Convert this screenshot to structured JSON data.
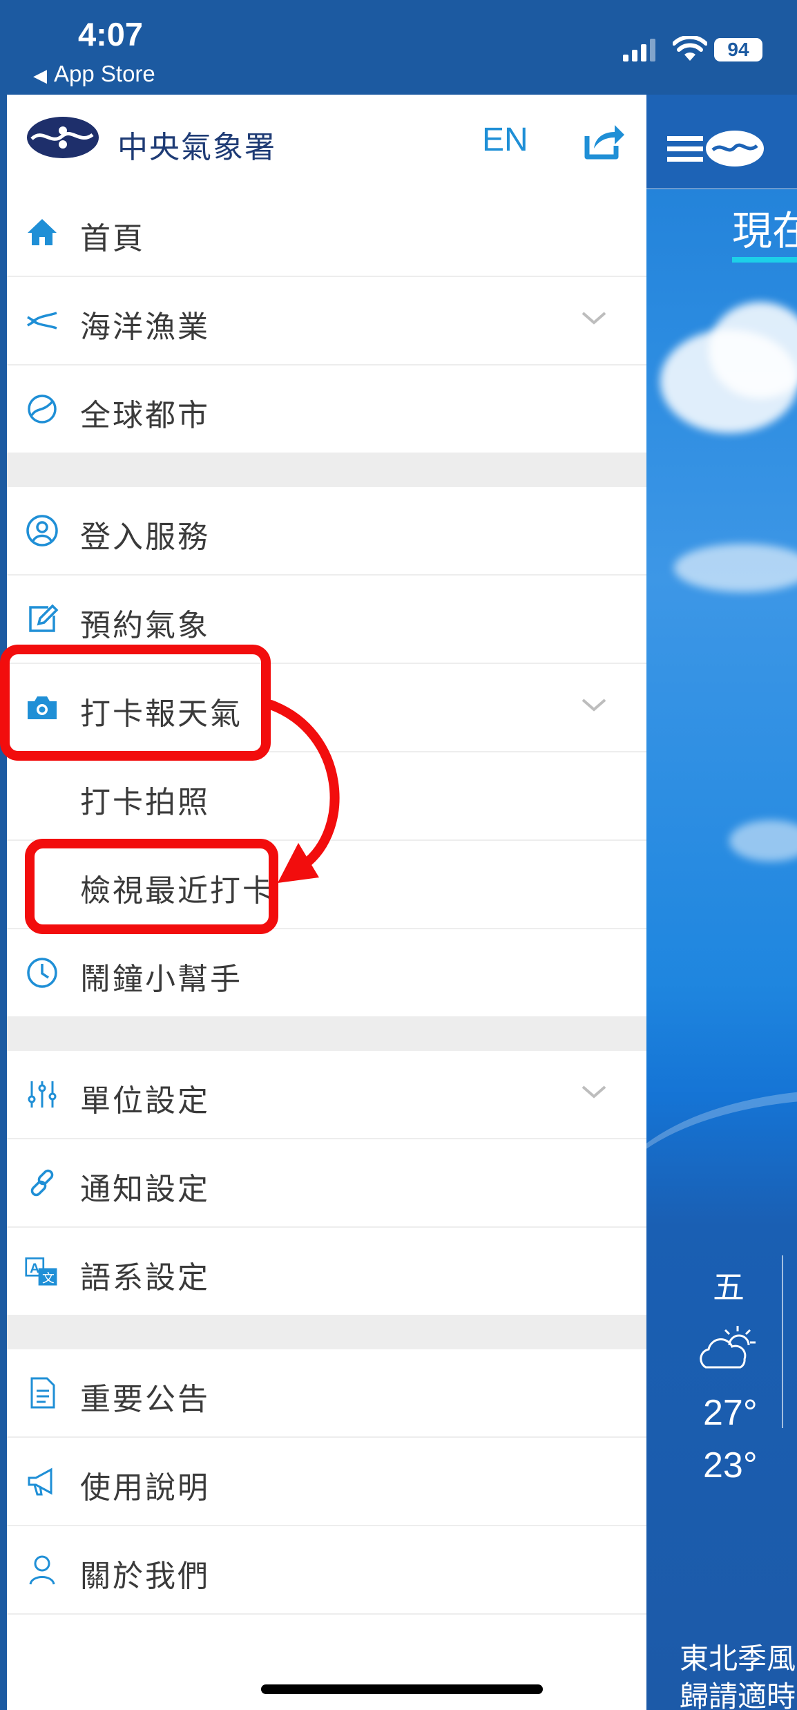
{
  "status_bar": {
    "time": "4:07",
    "back_label": "App Store",
    "battery": "94"
  },
  "drawer": {
    "org_name": "中央氣象署",
    "lang_button": "EN",
    "items": [
      {
        "label": "首頁",
        "icon": "home-icon"
      },
      {
        "label": "海洋漁業",
        "icon": "fish-icon",
        "expandable": true
      },
      {
        "label": "全球都市",
        "icon": "globe-icon"
      },
      {
        "label": "登入服務",
        "icon": "user-circle-icon"
      },
      {
        "label": "預約氣象",
        "icon": "edit-icon"
      },
      {
        "label": "打卡報天氣",
        "icon": "camera-icon",
        "expandable": true,
        "expanded": true
      },
      {
        "label": "打卡拍照",
        "sub": true
      },
      {
        "label": "檢視最近打卡",
        "sub": true
      },
      {
        "label": "鬧鐘小幫手",
        "icon": "clock-icon"
      },
      {
        "label": "單位設定",
        "icon": "sliders-icon",
        "expandable": true
      },
      {
        "label": "通知設定",
        "icon": "link-icon"
      },
      {
        "label": "語系設定",
        "icon": "translate-icon"
      },
      {
        "label": "重要公告",
        "icon": "document-icon"
      },
      {
        "label": "使用說明",
        "icon": "megaphone-icon"
      },
      {
        "label": "關於我們",
        "icon": "person-icon"
      }
    ]
  },
  "weather_panel": {
    "tab_label": "現在",
    "day": "五",
    "high": "27°",
    "low": "23°",
    "note_line1": "東北季風",
    "note_line2": "歸請適時"
  },
  "colors": {
    "accent": "#1f8fd6",
    "status_bar": "#1c5aa1",
    "annotation": "#f20d0d"
  }
}
